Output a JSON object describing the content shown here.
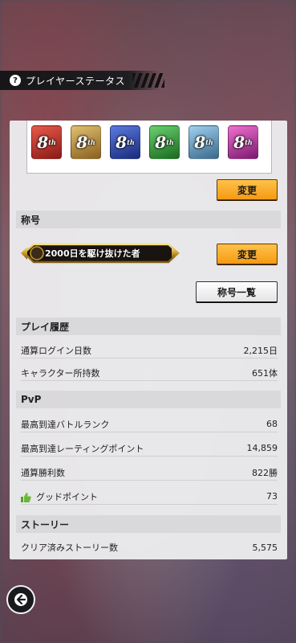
{
  "header": {
    "help_icon": "question-circle-icon",
    "help_glyph": "?",
    "title": "プレイヤーステータス"
  },
  "cards": [
    {
      "label": "8",
      "sup": "th",
      "color": "#c8322e"
    },
    {
      "label": "8",
      "sup": "th",
      "color": "#b88a3a"
    },
    {
      "label": "8",
      "sup": "th",
      "color": "#2a4fb8"
    },
    {
      "label": "8",
      "sup": "th",
      "color": "#2f9a40"
    },
    {
      "label": "8",
      "sup": "th",
      "color": "#6a9ab8"
    },
    {
      "label": "8",
      "sup": "th",
      "color": "#c040a8"
    }
  ],
  "buttons": {
    "change_cards": "変更",
    "change_title": "変更",
    "title_list": "称号一覧"
  },
  "title_section": {
    "heading": "称号",
    "current_title": "2000日を駆け抜けた者"
  },
  "play_history": {
    "heading": "プレイ履歴",
    "rows": [
      {
        "label": "通算ログイン日数",
        "value": "2,215日"
      },
      {
        "label": "キャラクター所持数",
        "value": "651体"
      }
    ]
  },
  "pvp": {
    "heading": "PvP",
    "rows": [
      {
        "label": "最高到達バトルランク",
        "value": "68"
      },
      {
        "label": "最高到達レーティングポイント",
        "value": "14,859"
      },
      {
        "label": "通算勝利数",
        "value": "822勝"
      },
      {
        "label": "グッドポイント",
        "value": "73",
        "icon": "thumbs-up-icon"
      }
    ]
  },
  "story": {
    "heading": "ストーリー",
    "rows": [
      {
        "label": "クリア済みストーリー数",
        "value": "5,575"
      }
    ]
  },
  "nav": {
    "back_icon": "arrow-left-icon"
  },
  "colors": {
    "accent_orange": "#f59a12",
    "header_bg": "#1e1e22",
    "panel_bg": "#ececee",
    "thumb_green": "#5aa02c"
  }
}
